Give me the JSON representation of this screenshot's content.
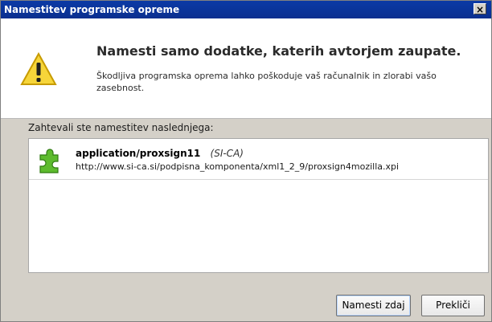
{
  "window": {
    "title": "Namestitev programske opreme",
    "close_symbol": "×"
  },
  "header": {
    "headline": "Namesti samo dodatke, katerih avtorjem zaupate.",
    "subtext": "Škodljiva programska oprema lahko poškoduje vaš računalnik in zlorabi vašo zasebnost.",
    "icon": "warning-icon"
  },
  "body": {
    "requested_label": "Zahtevali ste namestitev naslednjega:"
  },
  "items": [
    {
      "name": "application/proxsign11",
      "author": "(SI-CA)",
      "url": "http://www.si-ca.si/podpisna_komponenta/xml1_2_9/proxsign4mozilla.xpi",
      "icon": "puzzle-piece-icon"
    }
  ],
  "buttons": {
    "install": "Namesti zdaj",
    "cancel": "Prekliči"
  },
  "colors": {
    "titlebar": "#0b3aa6",
    "dialog_bg": "#d4d0c8",
    "warning_yellow": "#f6d53a",
    "addon_green": "#5dbb2e"
  }
}
